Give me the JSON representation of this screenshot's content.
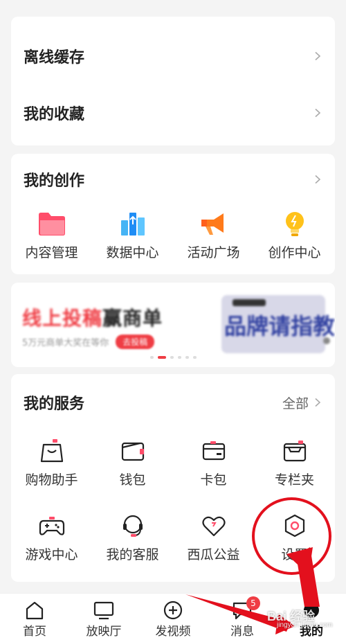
{
  "top_card": {
    "items": [
      {
        "label": "离线缓存"
      },
      {
        "label": "我的收藏"
      }
    ]
  },
  "creation": {
    "title": "我的创作",
    "items": [
      {
        "label": "内容管理",
        "icon": "folder-icon"
      },
      {
        "label": "数据中心",
        "icon": "bar-chart-icon"
      },
      {
        "label": "活动广场",
        "icon": "megaphone-icon"
      },
      {
        "label": "创作中心",
        "icon": "lightbulb-icon"
      }
    ]
  },
  "banner": {
    "title_red": "线上投稿",
    "title_dark": "赢商单",
    "subtitle": "5万元商单大奖在等你",
    "cta": "去投稿",
    "art_text": "品牌请指教",
    "pages": 6,
    "active_page": 2
  },
  "services": {
    "title": "我的服务",
    "more_label": "全部",
    "items": [
      {
        "label": "购物助手",
        "icon": "shopping-bag-icon"
      },
      {
        "label": "钱包",
        "icon": "wallet-icon"
      },
      {
        "label": "卡包",
        "icon": "card-icon"
      },
      {
        "label": "专栏夹",
        "icon": "column-folder-icon"
      },
      {
        "label": "游戏中心",
        "icon": "gamepad-icon"
      },
      {
        "label": "我的客服",
        "icon": "headset-icon"
      },
      {
        "label": "西瓜公益",
        "icon": "heart-icon"
      },
      {
        "label": "设置",
        "icon": "settings-icon"
      }
    ]
  },
  "bottom_nav": {
    "items": [
      {
        "label": "首页",
        "icon": "home-icon"
      },
      {
        "label": "放映厅",
        "icon": "tv-icon"
      },
      {
        "label": "发视频",
        "icon": "plus-circle-icon"
      },
      {
        "label": "消息",
        "icon": "message-icon",
        "badge": "5"
      },
      {
        "label": "我的",
        "icon": "profile-icon",
        "active": true
      }
    ]
  },
  "watermark": {
    "text": "Bai 经验",
    "sub": "jingyan.baidu.com"
  },
  "colors": {
    "accent": "#ef3d44",
    "annotation": "#e3101d",
    "background": "#f4f4f4"
  }
}
